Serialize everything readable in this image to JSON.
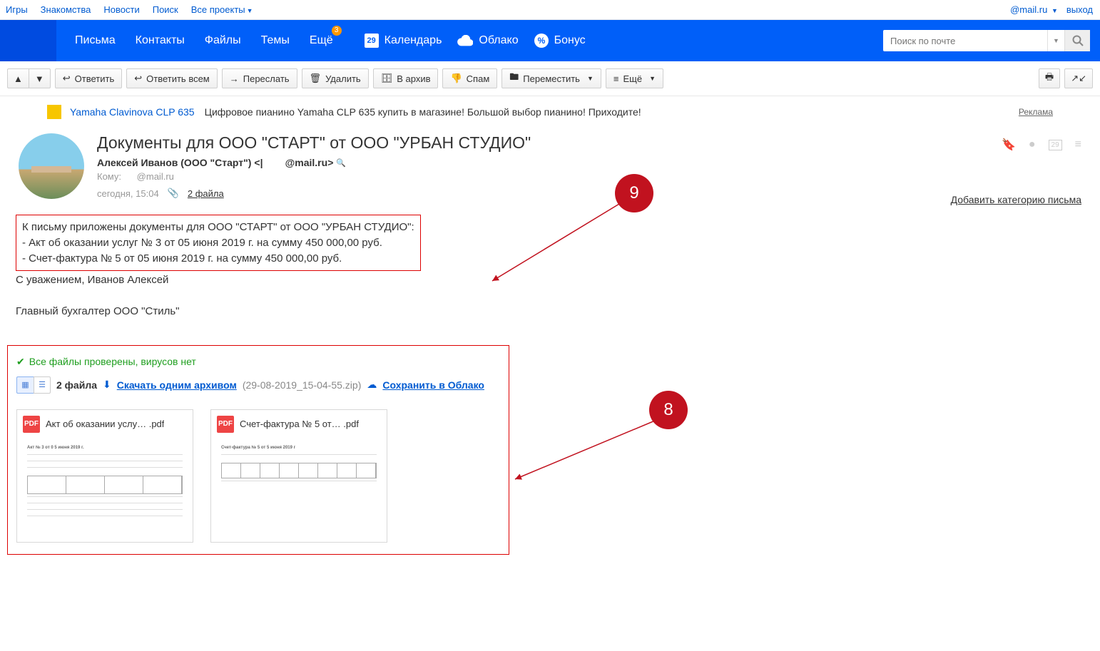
{
  "topnav": {
    "left": [
      "Игры",
      "Знакомства",
      "Новости",
      "Поиск",
      "Все проекты"
    ],
    "user": "@mail.ru",
    "logout": "выход"
  },
  "mainnav": {
    "items": [
      "Письма",
      "Контакты",
      "Файлы",
      "Темы",
      "Ещё"
    ],
    "badge": "3",
    "right": [
      "Календарь",
      "Облако",
      "Бонус"
    ],
    "calendar_day": "29"
  },
  "search": {
    "placeholder": "Поиск по почте"
  },
  "toolbar": {
    "reply": "Ответить",
    "reply_all": "Ответить всем",
    "forward": "Переслать",
    "delete": "Удалить",
    "archive": "В архив",
    "spam": "Спам",
    "move": "Переместить",
    "more": "Ещё"
  },
  "ad": {
    "link": "Yamaha Clavinova CLP 635",
    "text": "Цифровое пианино Yamaha CLP 635 купить в магазине! Большой выбор пианино! Приходите!",
    "label": "Реклама"
  },
  "email": {
    "subject": "Документы для ООО \"СТАРТ\" от ООО \"УРБАН СТУДИО\"",
    "from_name": "Алексей Иванов (ООО \"Старт\")",
    "from_email": "@mail.ru",
    "to_label": "Кому:",
    "to": "@mail.ru",
    "date": "сегодня, 15:04",
    "attachments_label": "2 файла",
    "add_category": "Добавить категорию письма"
  },
  "body": {
    "line1": "К письму приложены документы для ООО \"СТАРТ\" от ООО \"УРБАН СТУДИО\":",
    "line2": "- Акт об оказании услуг № 3 от 05 июня 2019 г. на сумму 450 000,00 руб.",
    "line3": "- Счет-фактура № 5 от 05 июня 2019 г. на сумму 450 000,00 руб.",
    "sig1": "С уважением, Иванов Алексей",
    "sig2": "Главный бухгалтер ООО \"Стиль\""
  },
  "attach": {
    "virus_ok": "Все файлы проверены, вирусов нет",
    "count": "2 файла",
    "download_all": "Скачать одним архивом",
    "zip": "(29-08-2019_15-04-55.zip)",
    "save_cloud": "Сохранить в Облако",
    "files": [
      {
        "name": "Акт об оказании услу… .pdf",
        "type": "PDF"
      },
      {
        "name": "Счет-фактура № 5 от… .pdf",
        "type": "PDF"
      }
    ]
  },
  "callouts": {
    "top": "9",
    "bottom": "8"
  }
}
